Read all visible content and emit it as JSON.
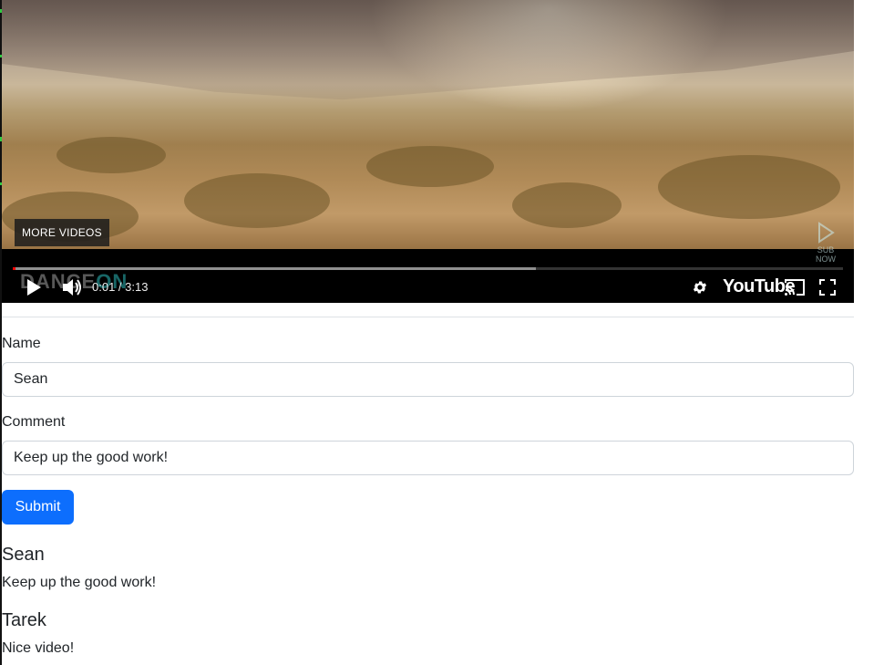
{
  "video": {
    "more_videos_label": "MORE VIDEOS",
    "time_display": "0:01 / 3:13",
    "brand_logo": "YouTube",
    "watermark_primary": "DANCE",
    "watermark_accent": "ON",
    "corner_logo_text": "SUB NOW",
    "progress_played_fraction": 0.003,
    "progress_buffered_fraction": 0.63,
    "icons": [
      "play-icon",
      "volume-icon",
      "settings-gear-icon",
      "cast-icon",
      "fullscreen-icon"
    ]
  },
  "form": {
    "name_label": "Name",
    "name_value": "Sean",
    "comment_label": "Comment",
    "comment_value": "Keep up the good work!",
    "submit_label": "Submit"
  },
  "comments": [
    {
      "name": "Sean",
      "text": "Keep up the good work!"
    },
    {
      "name": "Tarek",
      "text": "Nice video!"
    }
  ],
  "colors": {
    "primary": "#0d6efd",
    "progress_red": "#ff0000"
  }
}
